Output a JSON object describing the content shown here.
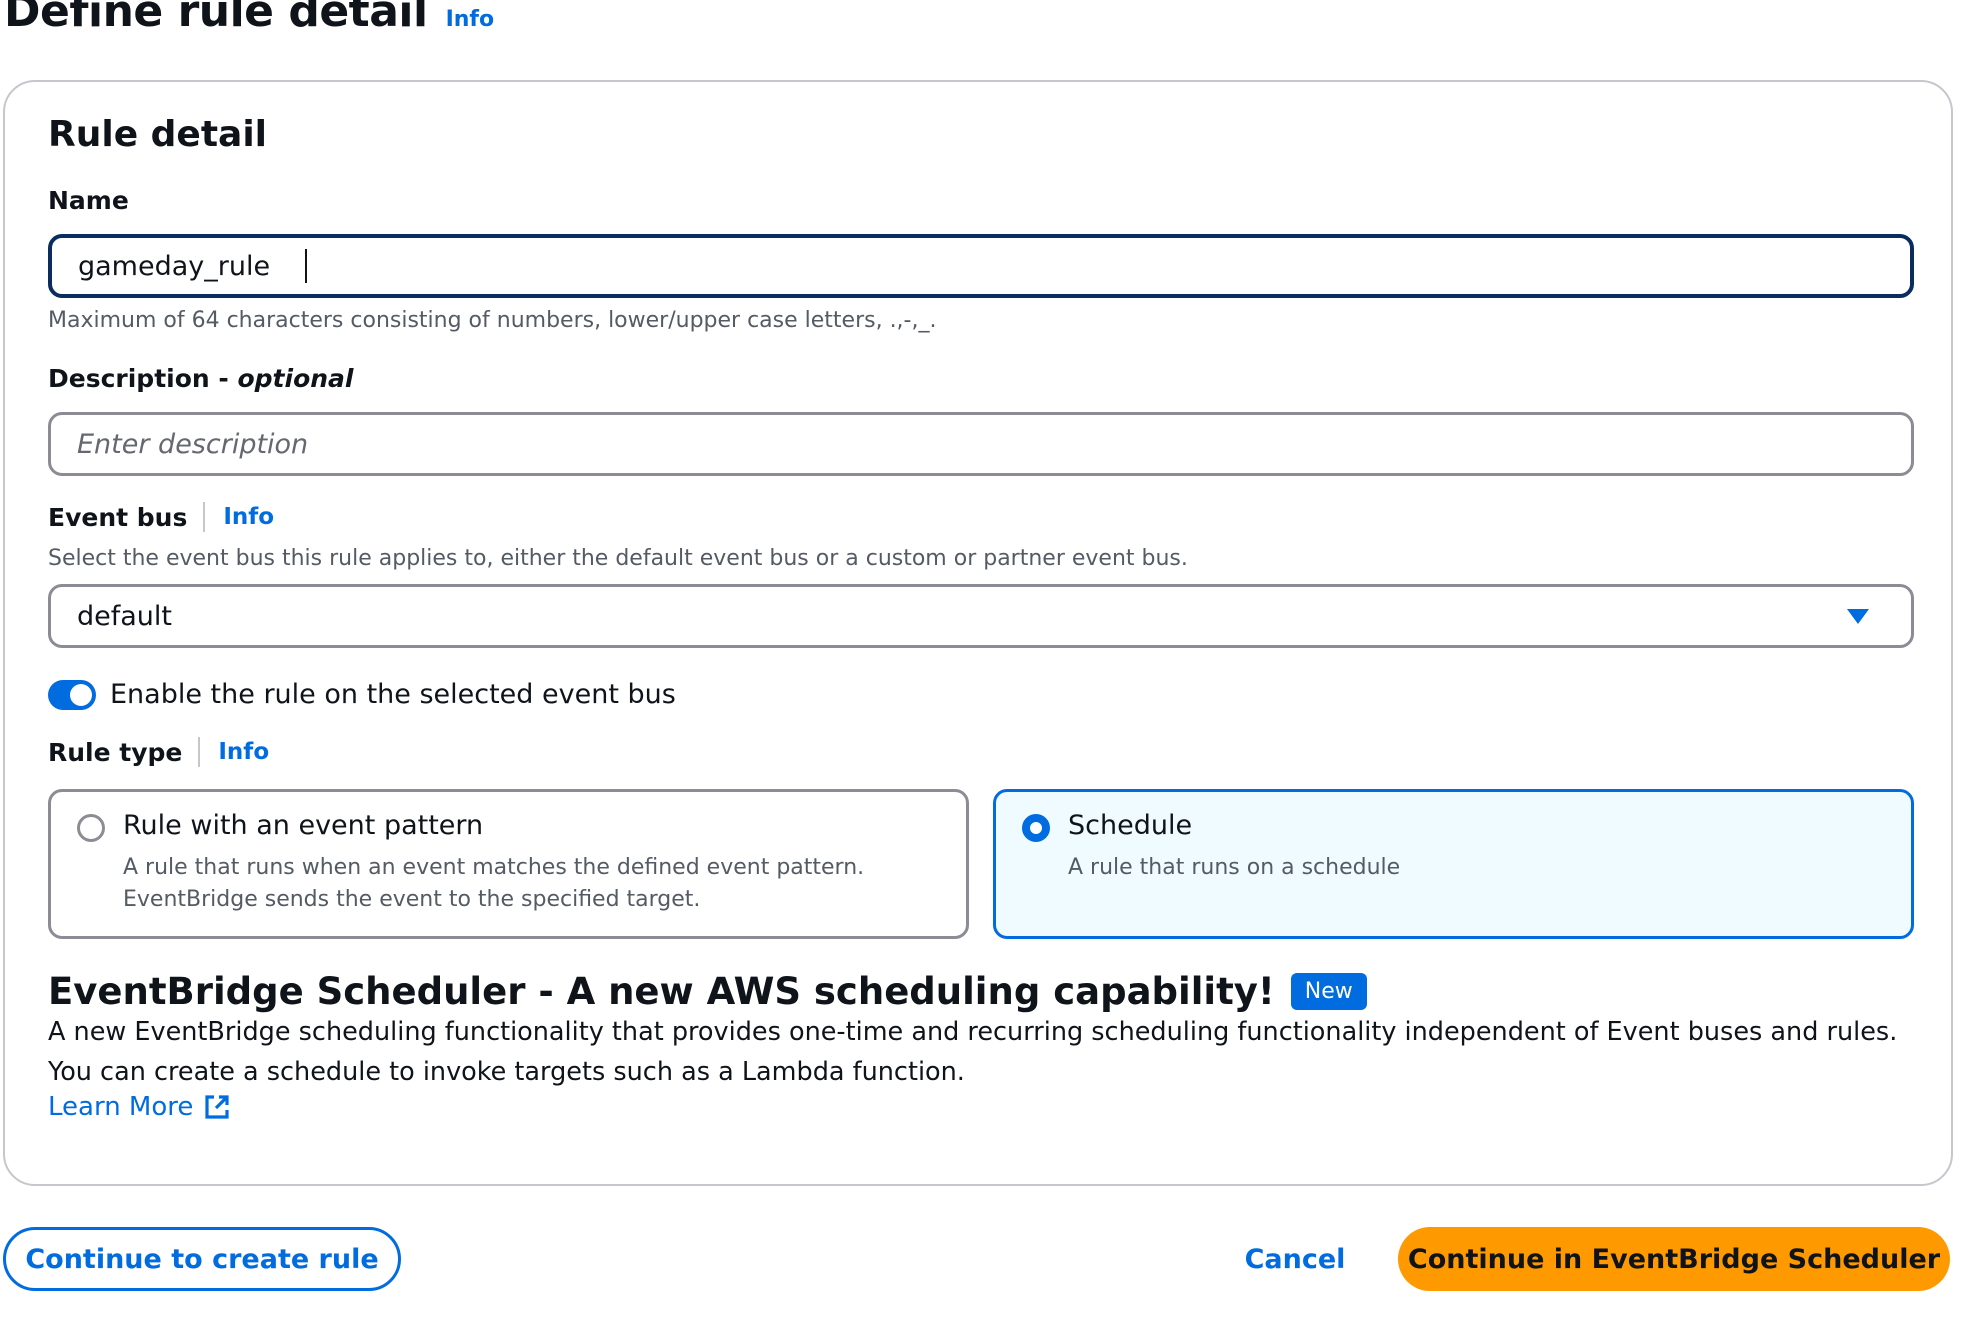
{
  "page": {
    "title": "Define rule detail",
    "info_label": "Info"
  },
  "card": {
    "title": "Rule detail"
  },
  "name_field": {
    "label": "Name",
    "value": "gameday_rule",
    "hint": "Maximum of 64 characters consisting of numbers, lower/upper case letters, .,-,_."
  },
  "description_field": {
    "label": "Description - ",
    "label_optional": "optional",
    "placeholder": "Enter description"
  },
  "event_bus": {
    "label": "Event bus",
    "info_label": "Info",
    "hint": "Select the event bus this rule applies to, either the default event bus or a custom or partner event bus.",
    "selected": "default"
  },
  "toggle": {
    "label": "Enable the rule on the selected event bus",
    "enabled": true,
    "accent": "#006ce0"
  },
  "rule_type": {
    "label": "Rule type",
    "info_label": "Info",
    "options": [
      {
        "title": "Rule with an event pattern",
        "description": "A rule that runs when an event matches the defined event pattern. EventBridge sends the event to the specified target.",
        "selected": false
      },
      {
        "title": "Schedule",
        "description": "A rule that runs on a schedule",
        "selected": true
      }
    ]
  },
  "promo": {
    "heading": "EventBridge Scheduler - A new AWS scheduling capability!",
    "badge": "New",
    "text_line1": "A new EventBridge scheduling functionality that provides one-time and recurring scheduling functionality independent of Event buses and rules.",
    "text_line2": "You can create a schedule to invoke targets such as a Lambda function.",
    "learn_more": "Learn More",
    "learn_more_icon": "external-link-icon"
  },
  "footer": {
    "secondary_label": "Continue to create rule",
    "cancel_label": "Cancel",
    "primary_label": "Continue in EventBridge Scheduler",
    "primary_color": "#ff9900"
  }
}
